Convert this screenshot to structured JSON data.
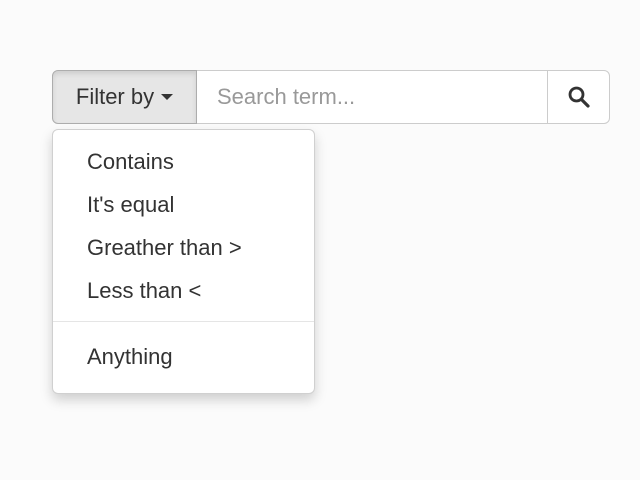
{
  "filter": {
    "label": "Filter by",
    "caret_icon": "caret-down-icon"
  },
  "search": {
    "value": "",
    "placeholder": "Search term...",
    "button_icon": "search-icon"
  },
  "dropdown": {
    "items": [
      {
        "label": "Contains"
      },
      {
        "label": "It's equal"
      },
      {
        "label": "Greather than >"
      },
      {
        "label": "Less than <"
      }
    ],
    "after_divider": [
      {
        "label": "Anything"
      }
    ]
  },
  "colors": {
    "button_active_bg": "#e6e6e6",
    "text": "#333333",
    "placeholder": "#999999",
    "border": "#cccccc"
  }
}
